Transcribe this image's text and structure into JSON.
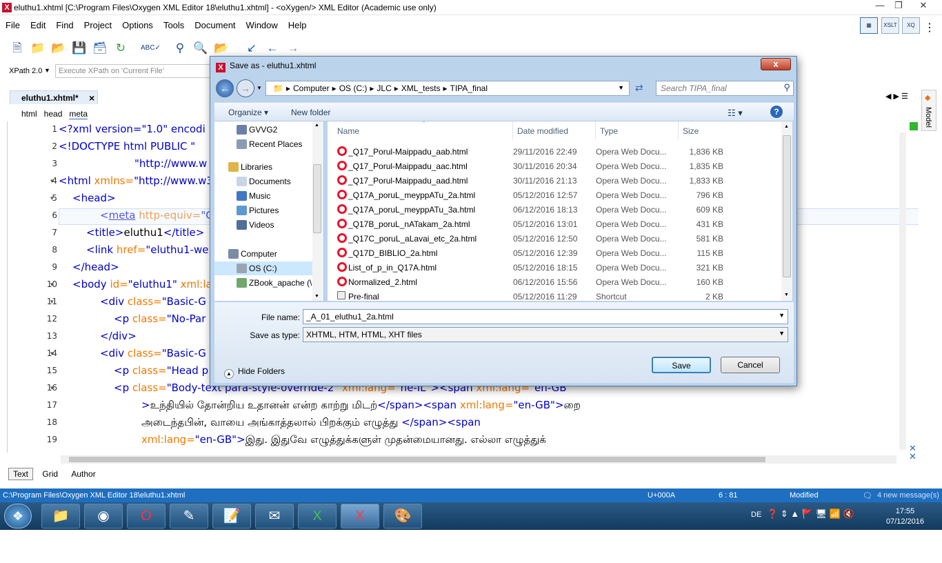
{
  "window": {
    "title": "eluthu1.xhtml [C:\\Program Files\\Oxygen XML Editor 18\\eluthu1.xhtml] - <oXygen/> XML Editor (Academic use only)"
  },
  "menu": [
    "File",
    "Edit",
    "Find",
    "Project",
    "Options",
    "Tools",
    "Document",
    "Window",
    "Help"
  ],
  "right_buttons": [
    "XSLT",
    "XQ"
  ],
  "xpath": {
    "version_label": "XPath 2.0",
    "placeholder": "Execute XPath on 'Current File'"
  },
  "editor_tab": {
    "label": "eluthu1.xhtml*",
    "close": "×"
  },
  "breadcrumb": [
    "html",
    "head",
    "meta"
  ],
  "side_panel": {
    "label": "Model"
  },
  "code_lines": [
    {
      "n": "1",
      "html": "<span class='pi'>&lt;?xml version=\"1.0\" encodi</span>"
    },
    {
      "n": "2",
      "html": "<span class='tagc'>&lt;!DOCTYPE html PUBLIC \"</span>"
    },
    {
      "n": "3",
      "html": "<span style='padding-left:110px' class='tagc'>\"http://www.w</span>"
    },
    {
      "n": "4",
      "html": "<span class='tagc'>&lt;html</span> <span class='attr'>xmlns=</span><span class='val'>\"http://www.w3</span>"
    },
    {
      "n": "5",
      "html": "<span style='padding-left:20px' class='tagc'>&lt;head&gt;</span>"
    },
    {
      "n": "6",
      "html": "<span style='padding-left:60px' class='tagc'>&lt;<u>meta</u></span> <span class='attr'>http-equiv=</span><span class='val'>\"C</span>"
    },
    {
      "n": "7",
      "html": "<span style='padding-left:40px' class='tagc'>&lt;title&gt;</span>eluthu1<span class='tagc'>&lt;/title&gt;</span>"
    },
    {
      "n": "8",
      "html": "<span style='padding-left:40px' class='tagc'>&lt;link</span> <span class='attr'>href=</span><span class='val'>\"eluthu1-we</span>"
    },
    {
      "n": "9",
      "html": "<span style='padding-left:20px' class='tagc'>&lt;/head&gt;</span>"
    },
    {
      "n": "10",
      "html": "<span style='padding-left:20px' class='tagc'>&lt;body</span> <span class='attr'>id=</span><span class='val'>\"eluthu1\"</span> <span class='attr'>xml:la</span>"
    },
    {
      "n": "11",
      "html": "<span style='padding-left:60px' class='tagc'>&lt;div</span> <span class='attr'>class=</span><span class='val'>\"Basic-G</span>"
    },
    {
      "n": "12",
      "html": "<span style='padding-left:80px' class='tagc'>&lt;p</span> <span class='attr'>class=</span><span class='val'>\"No-Par</span>"
    },
    {
      "n": "13",
      "html": "<span style='padding-left:60px' class='tagc'>&lt;/div&gt;</span>"
    },
    {
      "n": "14",
      "html": "<span style='padding-left:60px' class='tagc'>&lt;div</span> <span class='attr'>class=</span><span class='val'>\"Basic-G</span>"
    },
    {
      "n": "15",
      "html": "<span style='padding-left:80px' class='tagc'>&lt;p</span> <span class='attr'>class=</span><span class='val'>\"Head p</span>"
    },
    {
      "n": "16",
      "html": "<span style='padding-left:80px' class='tagc'>&lt;p</span> <span class='attr'>class=</span><span class='val'>\"Body-text para-style-override-2\"</span> <span class='attr'>xml:lang=</span><span class='val'>\"he-IL\"</span><span class='tagc'>&gt;&lt;span</span> <span class='attr'>xml:lang=</span><span class='val'>\"en-GB\"</span>"
    },
    {
      "n": "17",
      "html": "<span style='padding-left:120px' class='tagc'>&gt;</span>உந்தியில் தோன்றிய உதானன் என்ற காற்று மிடற்<span class='tagc'>&lt;/span&gt;&lt;span</span> <span class='attr'>xml:lang=</span><span class='val'>\"en-GB\"</span><span class='tagc'>&gt;</span>றை"
    },
    {
      "n": "18",
      "html": "<span style='padding-left:120px'>அடைந்தபின், வாயை அங்காத்தலால் பிறக்கும் எழுத்து </span><span class='tagc'>&lt;/span&gt;&lt;span</span>"
    },
    {
      "n": "19",
      "html": "<span style='padding-left:120px' class='attr'>xml:lang=</span><span class='val'>\"en-GB\"</span><span class='tagc'>&gt;</span>இது. இதுவே எழுத்துக்களுள் முதன்மையானது. எல்லா எழுத்துக்"
    }
  ],
  "mode_tabs": [
    "Text",
    "Grid",
    "Author"
  ],
  "status": {
    "path": "C:\\Program Files\\Oxygen XML Editor 18\\eluthu1.xhtml",
    "unicode": "U+000A",
    "position": "6 : 81",
    "state": "Modified",
    "messages": "4 new message(s)"
  },
  "taskbar": {
    "lang": "DE",
    "time": "17:55",
    "date": "07/12/2016"
  },
  "dialog": {
    "title": "Save as - eluthu1.xhtml",
    "close": "x",
    "path": [
      "Computer",
      "OS (C:)",
      "JLC",
      "XML_tests",
      "TIPA_final"
    ],
    "search_placeholder": "Search TIPA_final",
    "organize": "Organize ▾",
    "new_folder": "New folder",
    "nav_items": [
      {
        "label": "GVVG2",
        "color": "#6b7fa8",
        "indent": 0
      },
      {
        "label": "Recent Places",
        "color": "#8a9bb5",
        "indent": 0
      },
      {
        "label": "Libraries",
        "color": "#e0b44a",
        "indent": -12
      },
      {
        "label": "Documents",
        "color": "#c9d6e6",
        "indent": 0
      },
      {
        "label": "Music",
        "color": "#3f77c4",
        "indent": 0
      },
      {
        "label": "Pictures",
        "color": "#5d9ad1",
        "indent": 0
      },
      {
        "label": "Videos",
        "color": "#4f6f9a",
        "indent": 0
      },
      {
        "label": "Computer",
        "color": "#7b8ca4",
        "indent": -12
      },
      {
        "label": "OS (C:)",
        "color": "#9aa5b3",
        "indent": 0
      },
      {
        "label": "ZBook_apache (\\",
        "color": "#6ea86c",
        "indent": 0
      }
    ],
    "columns": {
      "name": "Name",
      "date": "Date modified",
      "type": "Type",
      "size": "Size"
    },
    "files": [
      {
        "name": "_Q17_Porul-Maippadu_aab.html",
        "date": "29/11/2016 22:49",
        "type": "Opera Web Docu...",
        "size": "1,836 KB",
        "kind": "opera"
      },
      {
        "name": "_Q17_Porul-Maippadu_aac.html",
        "date": "30/11/2016 20:34",
        "type": "Opera Web Docu...",
        "size": "1,835 KB",
        "kind": "opera"
      },
      {
        "name": "_Q17_Porul-Maippadu_aad.html",
        "date": "30/11/2016 21:13",
        "type": "Opera Web Docu...",
        "size": "1,833 KB",
        "kind": "opera"
      },
      {
        "name": "_Q17A_poruL_meyppATu_2a.html",
        "date": "05/12/2016 12:57",
        "type": "Opera Web Docu...",
        "size": "796 KB",
        "kind": "opera"
      },
      {
        "name": "_Q17A_poruL_meyppATu_3a.html",
        "date": "06/12/2016 18:13",
        "type": "Opera Web Docu...",
        "size": "609 KB",
        "kind": "opera"
      },
      {
        "name": "_Q17B_poruL_nATakam_2a.html",
        "date": "05/12/2016 13:01",
        "type": "Opera Web Docu...",
        "size": "431 KB",
        "kind": "opera"
      },
      {
        "name": "_Q17C_poruL_aLavai_etc_2a.html",
        "date": "05/12/2016 12:50",
        "type": "Opera Web Docu...",
        "size": "581 KB",
        "kind": "opera"
      },
      {
        "name": "_Q17D_BIBLIO_2a.html",
        "date": "05/12/2016 12:39",
        "type": "Opera Web Docu...",
        "size": "115 KB",
        "kind": "opera"
      },
      {
        "name": "List_of_p_in_Q17A.html",
        "date": "05/12/2016 18:15",
        "type": "Opera Web Docu...",
        "size": "321 KB",
        "kind": "opera"
      },
      {
        "name": "Normalized_2.html",
        "date": "06/12/2016 15:56",
        "type": "Opera Web Docu...",
        "size": "160 KB",
        "kind": "opera"
      },
      {
        "name": "Pre-final",
        "date": "05/12/2016 11:29",
        "type": "Shortcut",
        "size": "2 KB",
        "kind": "shortcut"
      }
    ],
    "file_name_label": "File name:",
    "file_name_value": "_A_01_eluthu1_2a.html",
    "save_type_label": "Save as type:",
    "save_type_value": "XHTML, HTM, HTML, XHT files",
    "hide_folders": "Hide Folders",
    "save": "Save",
    "cancel": "Cancel"
  }
}
